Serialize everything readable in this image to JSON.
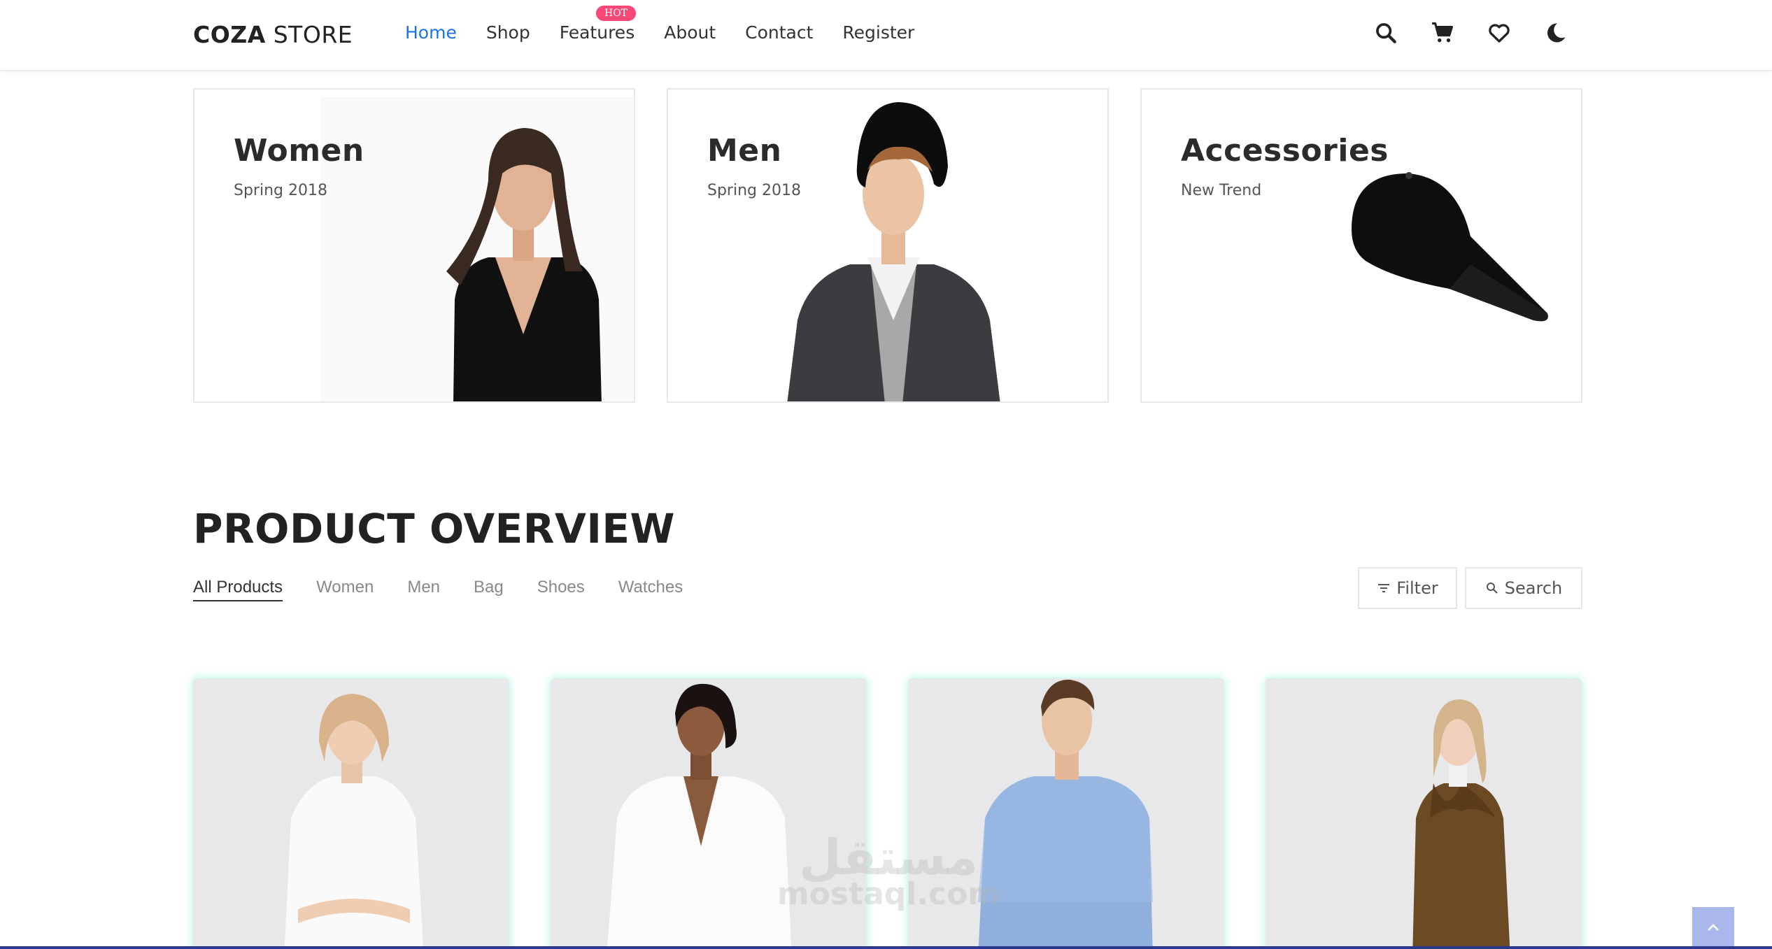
{
  "header": {
    "logo_bold": "COZA",
    "logo_rest": " STORE",
    "nav": [
      "Home",
      "Shop",
      "Features",
      "About",
      "Contact",
      "Register"
    ],
    "active_nav": "Home",
    "hot_badge": "HOT",
    "icons": [
      "search-icon",
      "cart-icon",
      "heart-icon",
      "moon-icon"
    ]
  },
  "banners": [
    {
      "title": "Women",
      "subtitle": "Spring 2018"
    },
    {
      "title": "Men",
      "subtitle": "Spring 2018"
    },
    {
      "title": "Accessories",
      "subtitle": "New Trend"
    }
  ],
  "overview": {
    "title": "PRODUCT OVERVIEW",
    "filters": [
      "All Products",
      "Women",
      "Men",
      "Bag",
      "Shoes",
      "Watches"
    ],
    "active_filter": "All Products",
    "filter_button": "Filter",
    "search_button": "Search"
  },
  "watermark": {
    "arabic": "مستقل",
    "latin": "mostaql.com"
  },
  "colors": {
    "accent": "#1a73e8",
    "hot": "#f74877",
    "scroll_top": "#aab7ea"
  }
}
